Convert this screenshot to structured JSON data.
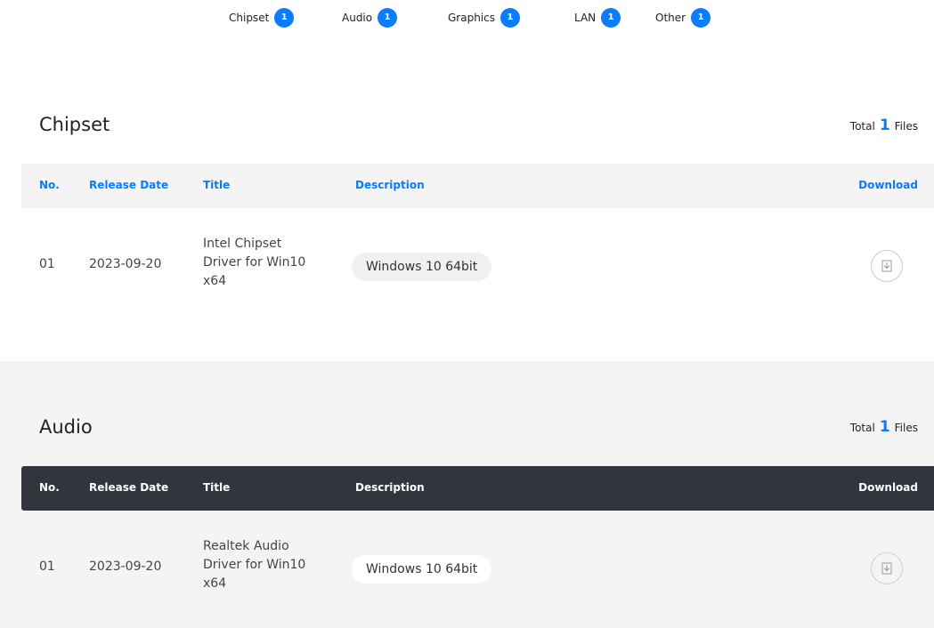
{
  "tabs": [
    {
      "label": "Chipset",
      "count": "1"
    },
    {
      "label": "Audio",
      "count": "1"
    },
    {
      "label": "Graphics",
      "count": "1"
    },
    {
      "label": "LAN",
      "count": "1"
    },
    {
      "label": "Other",
      "count": "1"
    }
  ],
  "table_headers": {
    "no": "No.",
    "release_date": "Release Date",
    "title": "Title",
    "description": "Description",
    "download": "Download"
  },
  "sections": [
    {
      "title": "Chipset",
      "total_prefix": "Total",
      "total_count": "1",
      "total_suffix": "Files",
      "rows": [
        {
          "no": "01",
          "release_date": "2023-09-20",
          "title": "Intel Chipset Driver for Win10 x64",
          "description": "Windows 10 64bit",
          "download_icon": "download-icon"
        }
      ]
    },
    {
      "title": "Audio",
      "total_prefix": "Total",
      "total_count": "1",
      "total_suffix": "Files",
      "rows": [
        {
          "no": "01",
          "release_date": "2023-09-20",
          "title": "Realtek Audio Driver for Win10 x64",
          "description": "Windows 10 64bit",
          "download_icon": "download-icon"
        }
      ]
    }
  ],
  "colors": {
    "accent": "#0a7cff",
    "dark_header": "#32343e",
    "light_bg": "#f4f4f4"
  }
}
